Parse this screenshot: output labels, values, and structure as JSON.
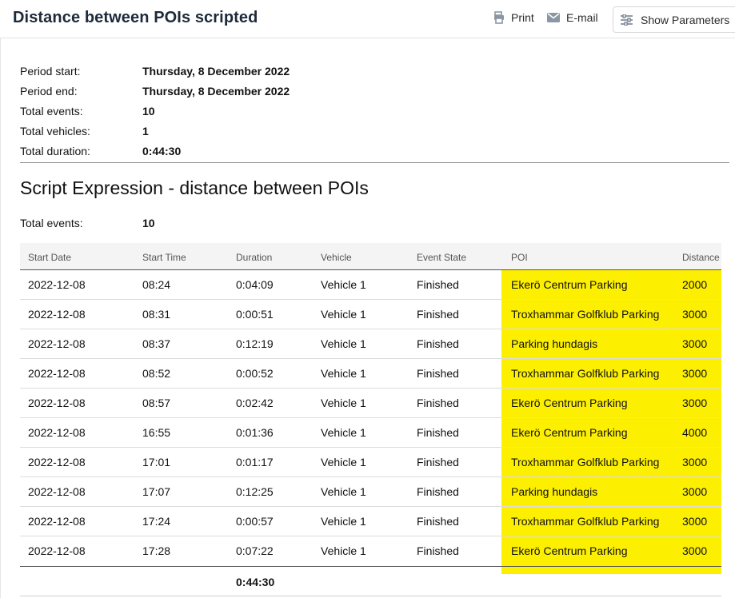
{
  "header": {
    "title": "Distance between POIs scripted",
    "print_label": "Print",
    "email_label": "E-mail",
    "params_label": "Show Parameters"
  },
  "summary": [
    {
      "label": "Period start:",
      "value": "Thursday, 8 December 2022"
    },
    {
      "label": "Period end:",
      "value": "Thursday, 8 December 2022"
    },
    {
      "label": "Total events:",
      "value": "10"
    },
    {
      "label": "Total vehicles:",
      "value": "1"
    },
    {
      "label": "Total duration:",
      "value": "0:44:30"
    }
  ],
  "section": {
    "title": "Script Expression - distance between POIs",
    "total_label": "Total events:",
    "total_value": "10"
  },
  "table": {
    "columns": [
      "Start Date",
      "Start Time",
      "Duration",
      "Vehicle",
      "Event State",
      "POI",
      "Distance"
    ],
    "rows": [
      [
        "2022-12-08",
        "08:24",
        "0:04:09",
        "Vehicle 1",
        "Finished",
        "Ekerö Centrum Parking",
        "2000"
      ],
      [
        "2022-12-08",
        "08:31",
        "0:00:51",
        "Vehicle 1",
        "Finished",
        "Troxhammar Golfklub Parking",
        "3000"
      ],
      [
        "2022-12-08",
        "08:37",
        "0:12:19",
        "Vehicle 1",
        "Finished",
        "Parking hundagis",
        "3000"
      ],
      [
        "2022-12-08",
        "08:52",
        "0:00:52",
        "Vehicle 1",
        "Finished",
        "Troxhammar Golfklub Parking",
        "3000"
      ],
      [
        "2022-12-08",
        "08:57",
        "0:02:42",
        "Vehicle 1",
        "Finished",
        "Ekerö Centrum Parking",
        "3000"
      ],
      [
        "2022-12-08",
        "16:55",
        "0:01:36",
        "Vehicle 1",
        "Finished",
        "Ekerö Centrum Parking",
        "4000"
      ],
      [
        "2022-12-08",
        "17:01",
        "0:01:17",
        "Vehicle 1",
        "Finished",
        "Troxhammar Golfklub Parking",
        "3000"
      ],
      [
        "2022-12-08",
        "17:07",
        "0:12:25",
        "Vehicle 1",
        "Finished",
        "Parking hundagis",
        "3000"
      ],
      [
        "2022-12-08",
        "17:24",
        "0:00:57",
        "Vehicle 1",
        "Finished",
        "Troxhammar Golfklub Parking",
        "3000"
      ],
      [
        "2022-12-08",
        "17:28",
        "0:07:22",
        "Vehicle 1",
        "Finished",
        "Ekerö Centrum Parking",
        "3000"
      ]
    ],
    "footer_duration": "0:44:30"
  },
  "icons": {
    "print": "print-icon",
    "email": "envelope-icon",
    "params": "sliders-icon"
  },
  "colors": {
    "highlight": "#fdef00",
    "title": "#1d2a3a"
  }
}
